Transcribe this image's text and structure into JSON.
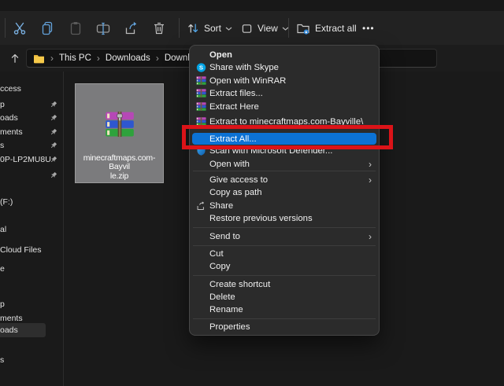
{
  "toolbar": {
    "buttons": [
      {
        "name": "cut"
      },
      {
        "name": "copy"
      },
      {
        "name": "paste"
      },
      {
        "name": "rename"
      },
      {
        "name": "share"
      },
      {
        "name": "delete"
      }
    ],
    "sort_label": "Sort",
    "view_label": "View",
    "extract_all_label": "Extract all",
    "more_label": "•••"
  },
  "breadcrumb": {
    "items": [
      "This PC",
      "Downloads",
      "Downloads"
    ]
  },
  "sidebar": {
    "items": [
      {
        "label": "ccess",
        "pinned": false
      },
      {
        "label": "p",
        "pinned": true
      },
      {
        "label": "oads",
        "pinned": true
      },
      {
        "label": "ments",
        "pinned": true
      },
      {
        "label": "s",
        "pinned": true
      },
      {
        "label": "0P-LP2MU8U",
        "pinned": true
      },
      {
        "label": "",
        "pinned": true
      },
      {
        "label": "(F:)",
        "pinned": false
      },
      {
        "label": "al",
        "pinned": false
      },
      {
        "label": "Cloud Files",
        "pinned": false
      },
      {
        "label": "e",
        "pinned": false
      },
      {
        "label": "p",
        "pinned": false
      },
      {
        "label": "ments",
        "pinned": false
      },
      {
        "label": "oads",
        "pinned": false,
        "selected": true
      },
      {
        "label": "s",
        "pinned": false
      }
    ]
  },
  "file": {
    "display_lines": [
      "minecraftmaps.com-Bayvil",
      "le.zip"
    ]
  },
  "context_menu": {
    "items": [
      {
        "label": "Open",
        "bold": true
      },
      {
        "label": "Share with Skype",
        "icon": "skype-icon"
      },
      {
        "label": "Open with WinRAR",
        "icon": "winrar-icon"
      },
      {
        "label": "Extract files...",
        "icon": "winrar-icon"
      },
      {
        "label": "Extract Here",
        "icon": "winrar-icon"
      },
      {
        "label": "Extract to minecraftmaps.com-Bayville\\",
        "icon": "winrar-icon"
      },
      {
        "label": "Extract All...",
        "highlighted": true
      },
      {
        "label": "Scan with Microsoft Defender...",
        "icon": "defender-icon"
      },
      {
        "label": "Open with",
        "submenu": true
      },
      {
        "label": "Give access to",
        "submenu": true
      },
      {
        "label": "Copy as path"
      },
      {
        "label": "Share",
        "icon": "share-icon"
      },
      {
        "label": "Restore previous versions"
      },
      {
        "label": "Send to",
        "submenu": true
      },
      {
        "label": "Cut"
      },
      {
        "label": "Copy"
      },
      {
        "label": "Create shortcut"
      },
      {
        "label": "Delete"
      },
      {
        "label": "Rename"
      },
      {
        "label": "Properties"
      }
    ]
  },
  "colors": {
    "accent_blue": "#0c72d4",
    "annotation_red": "#db1318",
    "skype_blue": "#00a3e4",
    "selection_gray": "#7b7b7d"
  }
}
